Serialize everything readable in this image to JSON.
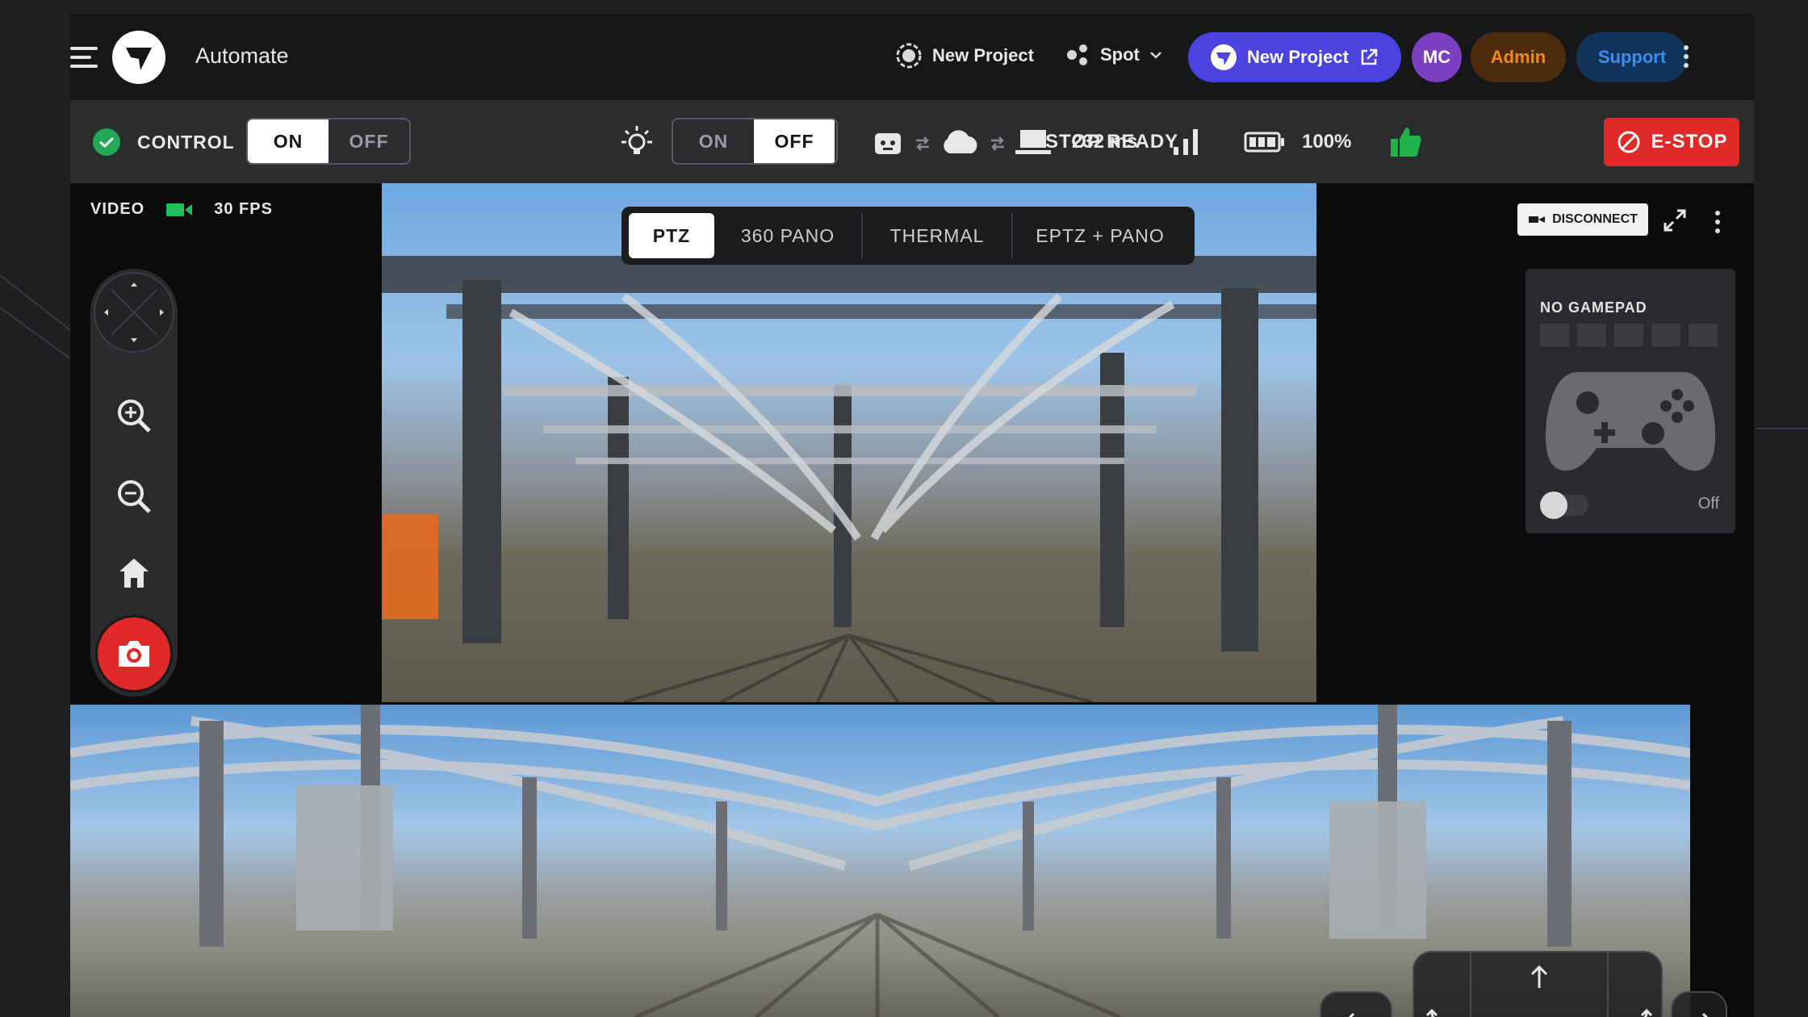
{
  "header": {
    "app_title": "Automate",
    "project_label": "New Project",
    "robot_label": "Spot",
    "new_project_button": "New Project",
    "user_initials": "MC",
    "admin_label": "Admin",
    "support_label": "Support"
  },
  "control_bar": {
    "control_label": "CONTROL",
    "control_on": "ON",
    "control_off": "OFF",
    "light_on": "ON",
    "light_off": "OFF",
    "latency": "232 ms",
    "battery": "100%",
    "estop_status": "ESTOP READY",
    "estop_button": "E-STOP"
  },
  "video": {
    "label": "VIDEO",
    "fps": "30 FPS",
    "tabs": [
      "PTZ",
      "360 PANO",
      "THERMAL",
      "EPTZ + PANO"
    ],
    "active_tab": "PTZ",
    "disconnect_label": "DISCONNECT"
  },
  "gamepad": {
    "title": "NO GAMEPAD",
    "toggle_state": "Off"
  },
  "colors": {
    "accent_purple": "#4b43e0",
    "estop_red": "#e02a2a",
    "status_green": "#23a85a",
    "admin_orange": "#f28a1a",
    "support_blue": "#3b8ff0"
  }
}
